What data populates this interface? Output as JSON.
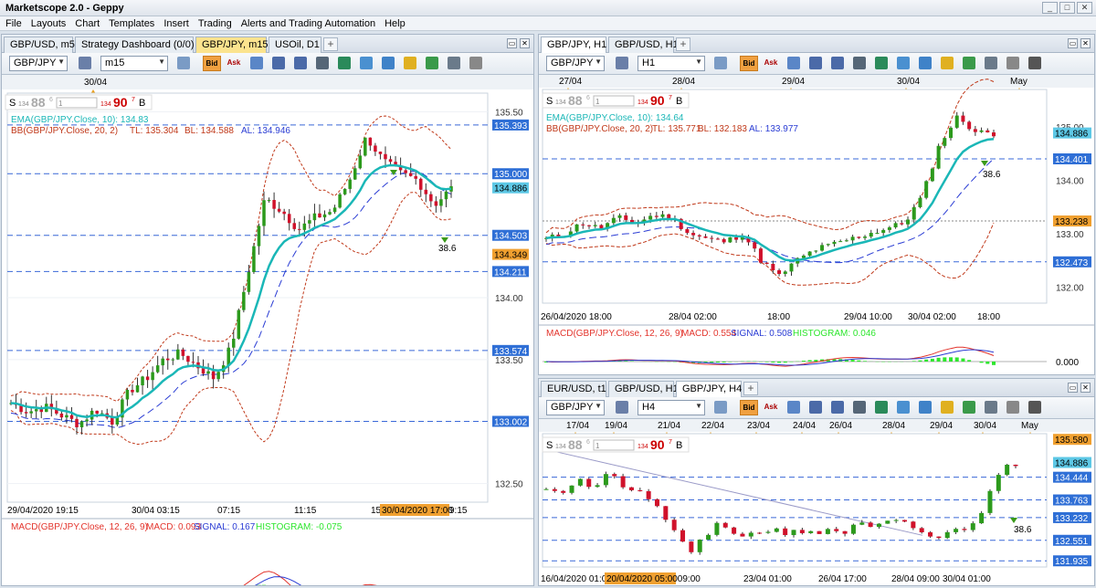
{
  "app": {
    "title": "Marketscope 2.0 - Geppy"
  },
  "menu": [
    "File",
    "Layouts",
    "Chart",
    "Templates",
    "Insert",
    "Trading",
    "Alerts and Trading Automation",
    "Help"
  ],
  "colors": {
    "up": "#2c9a1c",
    "down": "#d0112b",
    "ema": "#1ab7b7",
    "bb": "#c0391a",
    "macd": "#e3342c",
    "signal": "#2a3cd4",
    "hist": "#2ee62e",
    "bid": "#f0a040"
  },
  "left": {
    "tabs": [
      "GBP/USD, m5",
      "Strategy Dashboard (0/0)",
      "GBP/JPY, m15",
      "USOil, D1"
    ],
    "symbol": "GBP/JPY",
    "timeframe": "m15",
    "bid_label": "Bid",
    "ask_label": "Ask",
    "top_date": "30/04",
    "sell_price_small": "134",
    "sell_price_big": "88",
    "sell_sup": "6",
    "buy_price_small": "134",
    "buy_price_big": "90",
    "buy_sup": "7",
    "qty": "1",
    "ema_legend": "EMA(GBP/JPY.Close, 10): 134.83",
    "bb_legend": "BB(GBP/JPY.Close, 20, 2)",
    "bb_tl": "TL: 135.304",
    "bb_bl": "BL: 134.588",
    "bb_al": "AL: 134.946",
    "price_ticks": [
      "135.50",
      "135.00",
      "134.50",
      "134.00",
      "133.50",
      "133.00",
      "132.50"
    ],
    "price_tags": [
      {
        "v": "135.393",
        "t": "blue"
      },
      {
        "v": "135.000",
        "t": "blue"
      },
      {
        "v": "134.886",
        "t": "cyan"
      },
      {
        "v": "134.503",
        "t": "blue"
      },
      {
        "v": "134.349",
        "t": "orange"
      },
      {
        "v": "134.211",
        "t": "blue"
      },
      {
        "v": "133.574",
        "t": "blue"
      },
      {
        "v": "133.002",
        "t": "blue"
      }
    ],
    "time_labels": [
      "29/04/2020 19:15",
      "30/04 03:15",
      "07:15",
      "11:15",
      "15"
    ],
    "time_tag": "30/04/2020 17:00",
    "time_tail": "9:15",
    "annotation": "38.6",
    "macd_legend": "MACD(GBP/JPY.Close, 12, 26, 9)",
    "macd_value": "MACD: 0.093",
    "signal_value": "SIGNAL: 0.167",
    "hist_value": "HISTOGRAM: -0.075",
    "macd_zero": "0.000"
  },
  "right_top": {
    "tabs": [
      "GBP/JPY, H1",
      "GBP/USD, H1"
    ],
    "symbol": "GBP/JPY",
    "timeframe": "H1",
    "bid_label": "Bid",
    "ask_label": "Ask",
    "top_dates": [
      "27/04",
      "28/04",
      "29/04",
      "30/04",
      "May"
    ],
    "sell_price_small": "134",
    "sell_price_big": "88",
    "sell_sup": "6",
    "buy_price_small": "134",
    "buy_price_big": "90",
    "buy_sup": "7",
    "qty": "1",
    "ema_legend": "EMA(GBP/JPY.Close, 10): 134.64",
    "bb_legend": "BB(GBP/JPY.Close, 20, 2)",
    "bb_tl": "TL: 135.771",
    "bb_bl": "BL: 132.183",
    "bb_al": "AL: 133.977",
    "price_ticks": [
      "135.00",
      "134.00",
      "133.00",
      "132.00"
    ],
    "price_tags": [
      {
        "v": "134.886",
        "t": "cyan"
      },
      {
        "v": "134.401",
        "t": "blue"
      },
      {
        "v": "133.238",
        "t": "orange"
      },
      {
        "v": "132.473",
        "t": "blue"
      }
    ],
    "time_labels": [
      "26/04/2020 18:00",
      "28/04 02:00",
      "18:00",
      "29/04 10:00",
      "30/04 02:00",
      "18:00"
    ],
    "annotation": "38.6",
    "macd_legend": "MACD(GBP/JPY.Close, 12, 26, 9)",
    "macd_value": "MACD: 0.554",
    "signal_value": "SIGNAL: 0.508",
    "hist_value": "HISTOGRAM: 0.046",
    "macd_zero": "0.000"
  },
  "right_bottom": {
    "tabs": [
      "EUR/USD, t1",
      "GBP/USD, H1",
      "GBP/JPY, H4"
    ],
    "symbol": "GBP/JPY",
    "timeframe": "H4",
    "bid_label": "Bid",
    "ask_label": "Ask",
    "top_dates": [
      "17/04",
      "19/04",
      "21/04",
      "22/04",
      "23/04",
      "24/04",
      "26/04",
      "28/04",
      "29/04",
      "30/04",
      "May"
    ],
    "sell_price_small": "134",
    "sell_price_big": "88",
    "sell_sup": "6",
    "buy_price_small": "134",
    "buy_price_big": "90",
    "buy_sup": "7",
    "qty": "1",
    "price_tags": [
      {
        "v": "135.580",
        "t": "orange"
      },
      {
        "v": "134.886",
        "t": "cyan"
      },
      {
        "v": "134.444",
        "t": "blue"
      },
      {
        "v": "133.763",
        "t": "blue"
      },
      {
        "v": "133.232",
        "t": "blue"
      },
      {
        "v": "132.551",
        "t": "blue"
      },
      {
        "v": "131.935",
        "t": "blue"
      }
    ],
    "time_labels": [
      "16/04/2020 01:0",
      "21/04 09:00",
      "23/04 01:00",
      "26/04 17:00",
      "28/04 09:00",
      "30/04 01:00"
    ],
    "time_tag": "20/04/2020 05:00",
    "annotation": "38.6"
  }
}
